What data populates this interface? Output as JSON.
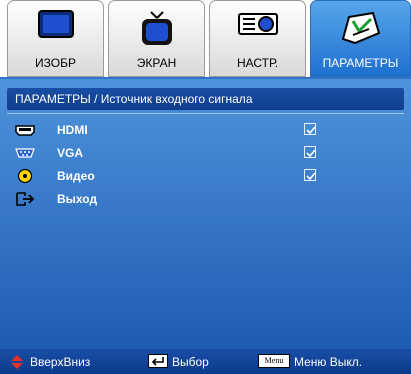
{
  "tabs": [
    {
      "label": "ИЗОБР",
      "icon": "monitor-icon",
      "active": false
    },
    {
      "label": "ЭКРАН",
      "icon": "tv-icon",
      "active": false
    },
    {
      "label": "НАСТР.",
      "icon": "projector-icon",
      "active": false
    },
    {
      "label": "ПАРАМЕТРЫ",
      "icon": "options-icon",
      "active": true
    }
  ],
  "breadcrumb": "ПАРАМЕТРЫ / Источник входного сигнала",
  "items": [
    {
      "label": "HDMI",
      "icon": "hdmi-icon",
      "checked": true
    },
    {
      "label": "VGA",
      "icon": "vga-icon",
      "checked": true
    },
    {
      "label": "Видео",
      "icon": "video-icon",
      "checked": true
    },
    {
      "label": "Выход",
      "icon": "exit-icon",
      "checked": null
    }
  ],
  "hints": [
    {
      "label": "ВверхВниз",
      "icon": "up-down-arrows-icon"
    },
    {
      "label": "Выбор",
      "icon": "enter-key-icon"
    },
    {
      "label": "Меню Выкл.",
      "key_text": "Menu",
      "icon": "menu-key-icon"
    }
  ],
  "colors": {
    "panel_blue": "#2f73c9",
    "active_tab_blue": "#2f7fd7",
    "header_dark_blue": "#0f3d8c"
  }
}
